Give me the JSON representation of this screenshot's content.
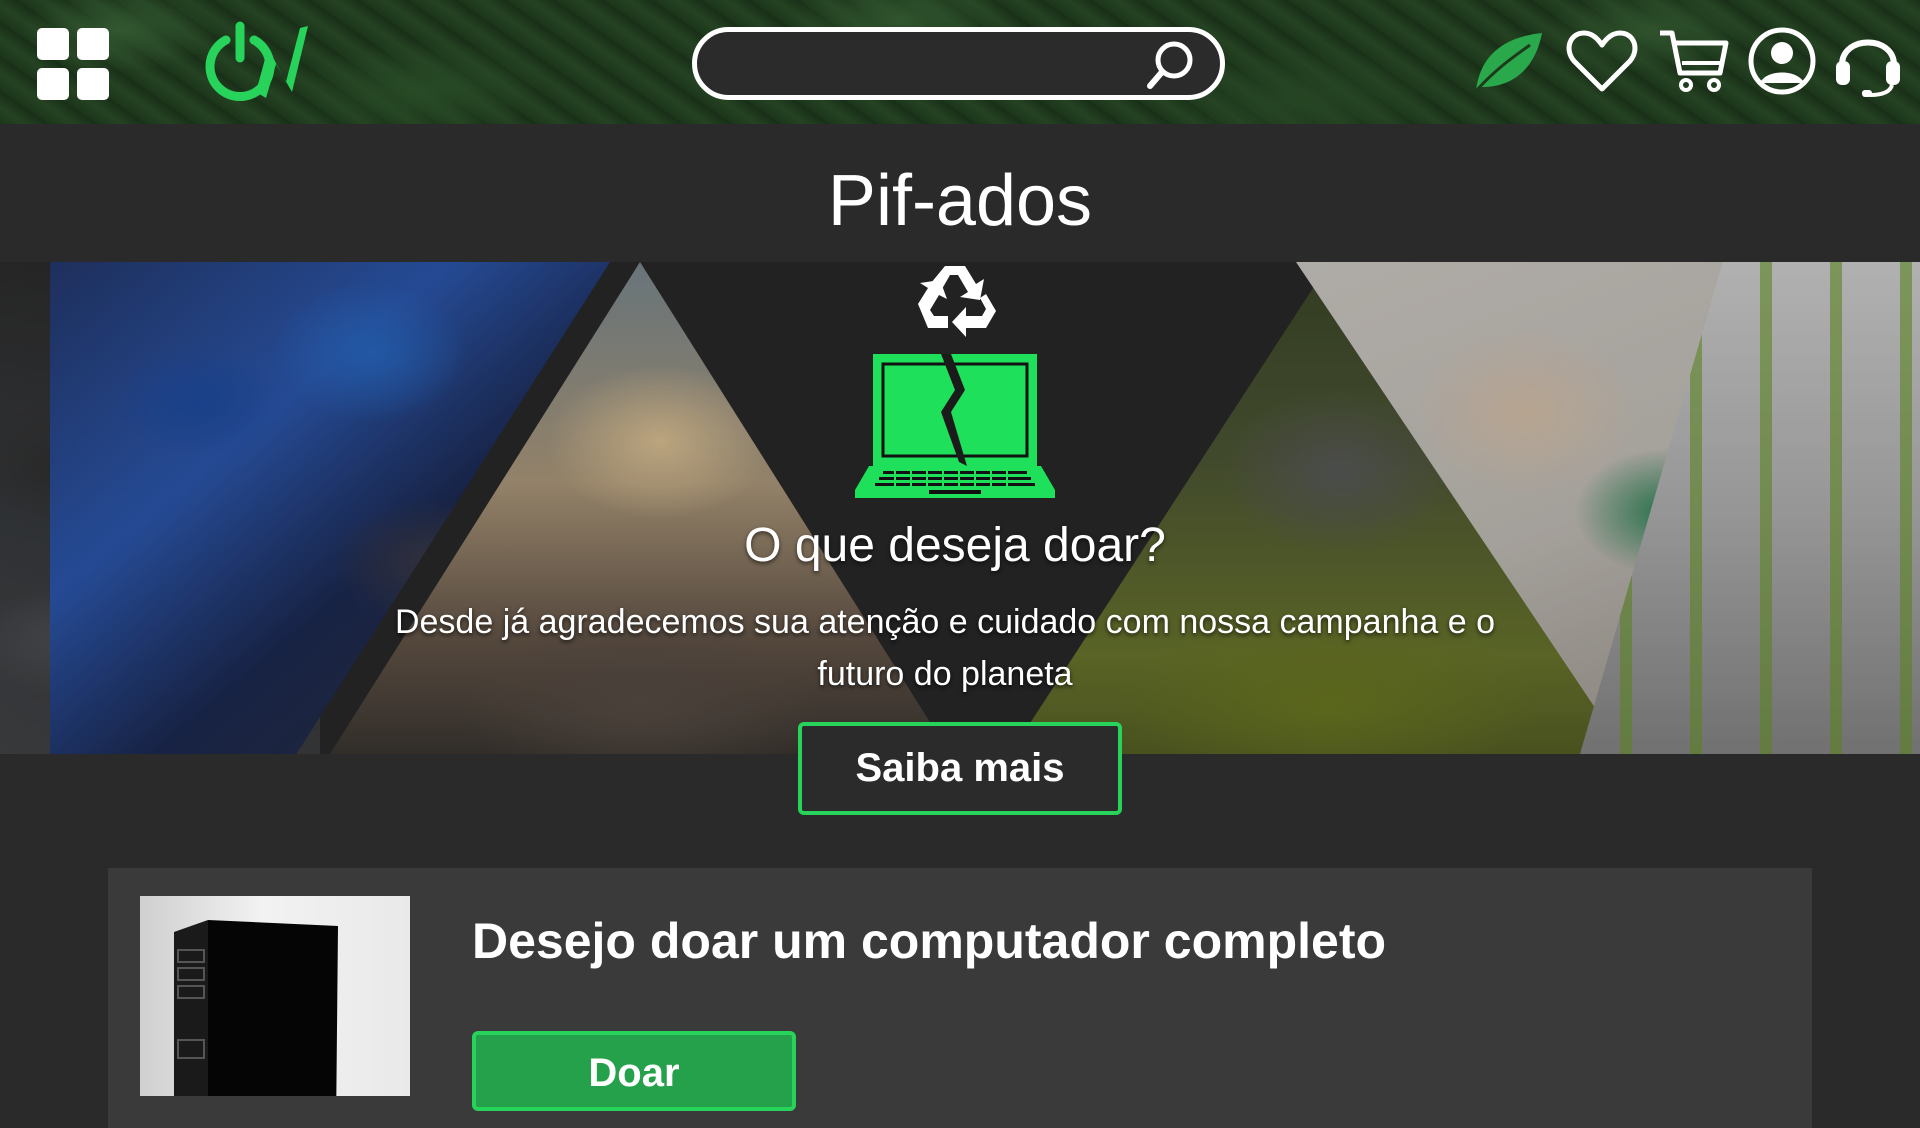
{
  "header": {
    "menu_icon": "grid-icon",
    "logo_icon": "power-leaf-logo",
    "search": {
      "placeholder": "",
      "value": "",
      "icon": "search-icon"
    },
    "actions": [
      {
        "name": "eco-leaf-icon",
        "color": "#2aa84c"
      },
      {
        "name": "favorites-heart-icon"
      },
      {
        "name": "cart-icon"
      },
      {
        "name": "account-icon"
      },
      {
        "name": "support-headset-icon"
      }
    ]
  },
  "hero": {
    "title": "Pif-ados",
    "icons": [
      "recycle-icon",
      "broken-laptop-icon"
    ],
    "question": "O que deseja doar?",
    "description": "Desde já agradecemos sua atenção e cuidado com nossa campanha e o futuro do planeta",
    "cta_label": "Saiba mais"
  },
  "card": {
    "image_icon": "computer-tower-image",
    "title": "Desejo doar um computador completo",
    "button_label": "Doar"
  },
  "colors": {
    "accent_green": "#27d35a",
    "button_green": "#25a14c",
    "background": "#2a2a2a",
    "card_background": "#3a3a3a"
  }
}
